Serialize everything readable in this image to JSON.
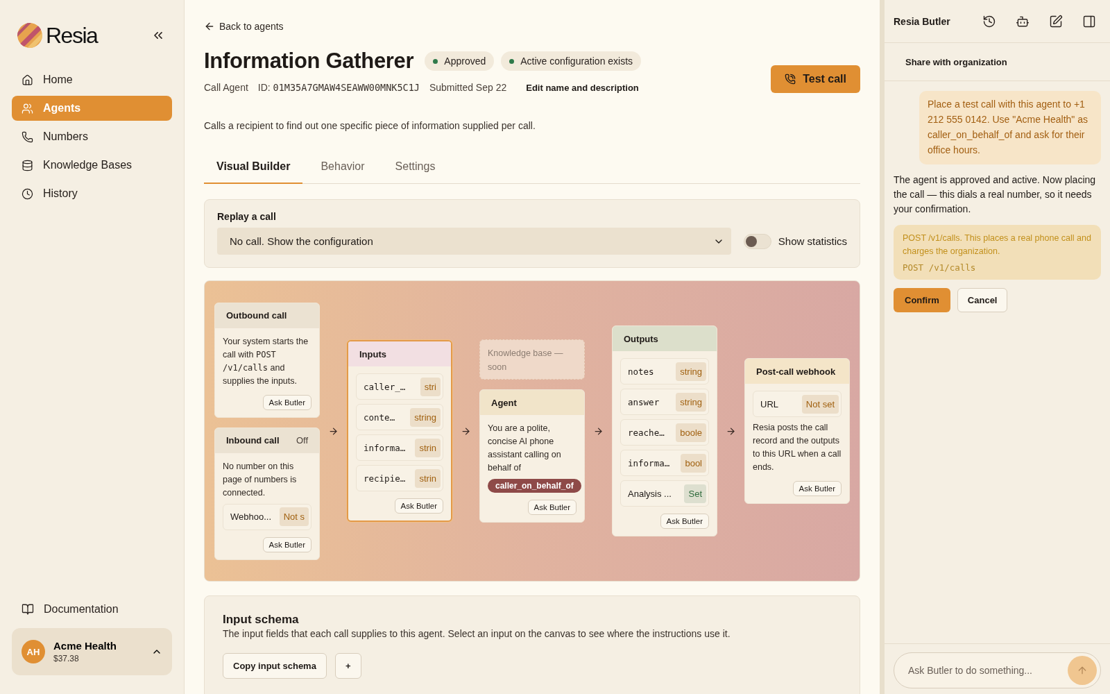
{
  "brand": {
    "name": "Resia"
  },
  "nav": [
    {
      "label": "Home",
      "selected": false
    },
    {
      "label": "Agents",
      "selected": true
    },
    {
      "label": "Numbers",
      "selected": false
    },
    {
      "label": "Knowledge Bases",
      "selected": false
    },
    {
      "label": "History",
      "selected": false
    }
  ],
  "docs_link": "Documentation",
  "account": {
    "initials": "AH",
    "name": "Acme Health",
    "balance": "$37.38"
  },
  "back_link": "Back to agents",
  "title": "Information Gatherer",
  "badges": [
    {
      "label": "Approved",
      "color": "#2f7a4a"
    },
    {
      "label": "Active configuration exists",
      "color": "#2f7a4a"
    }
  ],
  "meta": {
    "type": "Call Agent",
    "id_label": "ID:",
    "id": "01M35A7GMAW4SEAWW00MNK5C1J",
    "submitted": "Submitted Sep 22",
    "edit_link": "Edit name and description"
  },
  "test_call_button": "Test call",
  "description": "Calls a recipient to find out one specific piece of information supplied per call.",
  "tabs": [
    {
      "label": "Visual Builder",
      "selected": true
    },
    {
      "label": "Behavior",
      "selected": false
    },
    {
      "label": "Settings",
      "selected": false
    }
  ],
  "replay": {
    "label": "Replay a call",
    "select_value": "No call. Show the configuration",
    "toggle_label": "Show statistics",
    "on": false
  },
  "canvas": {
    "columns": [
      [
        {
          "kind": "card",
          "title": "Outbound call",
          "color": "#ebe2d2",
          "selected": false,
          "blocks": [
            {
              "kind": "text",
              "parts": [
                {
                  "kind": "text",
                  "text": "Your system starts the call with "
                },
                {
                  "kind": "code",
                  "text": "POST /v1/calls"
                },
                {
                  "kind": "text",
                  "text": " and supplies the inputs."
                }
              ]
            }
          ],
          "button": "Ask Butler"
        },
        {
          "kind": "card",
          "title": "Inbound call",
          "status": "Off",
          "color": "#ebe2d2",
          "selected": false,
          "blocks": [
            {
              "kind": "text",
              "parts": [
                {
                  "kind": "text",
                  "text": "No number on this page of numbers is connected."
                }
              ]
            },
            {
              "kind": "field",
              "name": "Webhoo...",
              "tag": "Not s",
              "mono": false,
              "color": "#a0600f"
            }
          ],
          "button": "Ask Butler"
        }
      ],
      [
        {
          "kind": "card",
          "title": "Inputs",
          "color": "#f2dfe2",
          "selected": true,
          "blocks": [
            {
              "kind": "field",
              "name": "caller_…",
              "tag": "stri",
              "mono": true,
              "color": "#a0600f"
            },
            {
              "kind": "field",
              "name": "conte…",
              "tag": "string",
              "mono": true,
              "color": "#a0600f"
            },
            {
              "kind": "field",
              "name": "informa…",
              "tag": "strin",
              "mono": true,
              "color": "#a0600f"
            },
            {
              "kind": "field",
              "name": "recipie…",
              "tag": "strin",
              "mono": true,
              "color": "#a0600f"
            }
          ],
          "button": "Ask Butler"
        }
      ],
      [
        {
          "kind": "placeholder",
          "title": "Knowledge base — soon"
        },
        {
          "kind": "card",
          "title": "Agent",
          "color": "#f1e4c9",
          "selected": false,
          "blocks": [
            {
              "kind": "text",
              "parts": [
                {
                  "kind": "text",
                  "text": "You are a polite, concise AI phone assistant calling on behalf of"
                }
              ]
            },
            {
              "kind": "token",
              "text": "caller_on_behalf_of"
            }
          ],
          "button": "Ask Butler"
        }
      ],
      [
        {
          "kind": "card",
          "title": "Outputs",
          "color": "#dcdfcb",
          "selected": false,
          "blocks": [
            {
              "kind": "field",
              "name": "notes",
              "tag": "string",
              "mono": true,
              "color": "#a0600f"
            },
            {
              "kind": "field",
              "name": "answer",
              "tag": "string",
              "mono": true,
              "color": "#a0600f"
            },
            {
              "kind": "field",
              "name": "reache…",
              "tag": "boole",
              "mono": true,
              "color": "#a0600f"
            },
            {
              "kind": "field",
              "name": "informa…",
              "tag": "bool",
              "mono": true,
              "color": "#a0600f"
            },
            {
              "kind": "field",
              "name": "Analysis ...",
              "tag": "Set",
              "mono": false,
              "color": "#2f6b3c"
            }
          ],
          "button": "Ask Butler"
        }
      ],
      [
        {
          "kind": "card",
          "title": "Post-call webhook",
          "color": "#f4e5c8",
          "selected": false,
          "blocks": [
            {
              "kind": "field",
              "name": "URL",
              "tag": "Not set",
              "mono": false,
              "color": "#a0600f"
            },
            {
              "kind": "text",
              "parts": [
                {
                  "kind": "text",
                  "text": "Resia posts the call record and the outputs to this URL when a call ends."
                }
              ]
            }
          ],
          "button": "Ask Butler"
        }
      ]
    ]
  },
  "input_schema": {
    "title": "Input schema",
    "description": "The input fields that each call supplies to this agent. Select an input on the canvas to see where the instructions use it.",
    "copy_button": "Copy input schema",
    "add_button": "+"
  },
  "butler": {
    "title": "Resia Butler",
    "share": "Share with organization",
    "user_message": "Place a test call with this agent to +1 212 555 0142. Use \"Acme Health\" as caller_on_behalf_of and ask for their office hours.",
    "assistant_message": "The agent is approved and active. Now placing the call — this dials a real number, so it needs your confirmation.",
    "confirm_box": {
      "text": "POST /v1/calls. This places a real phone call and charges the organization.",
      "code": "POST /v1/calls"
    },
    "confirm": "Confirm",
    "cancel": "Cancel",
    "composer_placeholder": "Ask Butler to do something..."
  }
}
